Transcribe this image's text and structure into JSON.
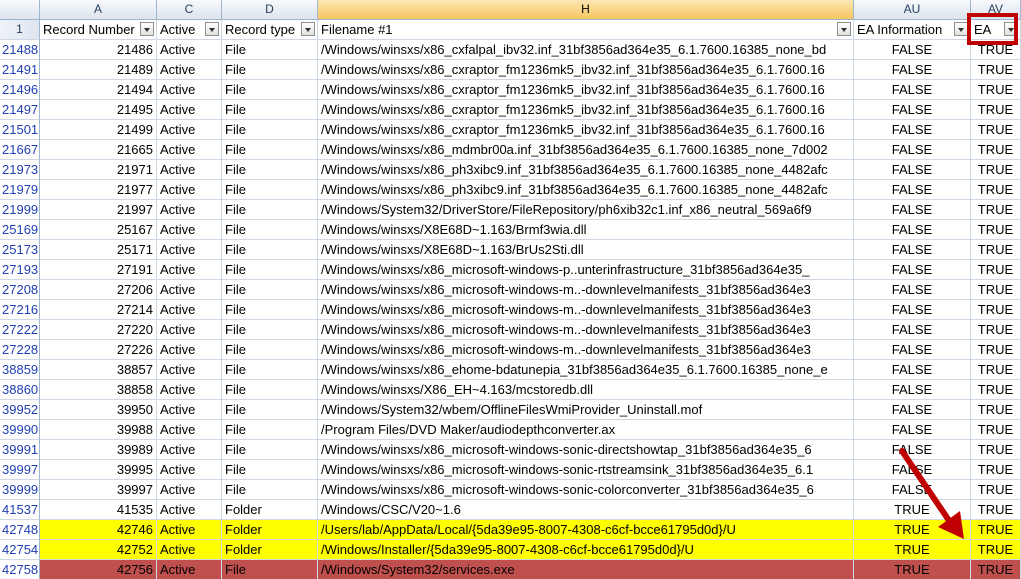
{
  "columns": {
    "corner": "",
    "letters": [
      "A",
      "C",
      "D",
      "H",
      "AU",
      "AV"
    ],
    "header_row_number": "1",
    "headers": [
      "Record Number",
      "Active",
      "Record type",
      "Filename #1",
      "EA Information",
      "EA"
    ]
  },
  "rows": [
    {
      "row": "21488",
      "rec": "21486",
      "active": "Active",
      "type": "File",
      "file": "/Windows/winsxs/x86_cxfalpal_ibv32.inf_31bf3856ad364e35_6.1.7600.16385_none_bd",
      "eai": "FALSE",
      "ea": "TRUE"
    },
    {
      "row": "21491",
      "rec": "21489",
      "active": "Active",
      "type": "File",
      "file": "/Windows/winsxs/x86_cxraptor_fm1236mk5_ibv32.inf_31bf3856ad364e35_6.1.7600.16",
      "eai": "FALSE",
      "ea": "TRUE"
    },
    {
      "row": "21496",
      "rec": "21494",
      "active": "Active",
      "type": "File",
      "file": "/Windows/winsxs/x86_cxraptor_fm1236mk5_ibv32.inf_31bf3856ad364e35_6.1.7600.16",
      "eai": "FALSE",
      "ea": "TRUE"
    },
    {
      "row": "21497",
      "rec": "21495",
      "active": "Active",
      "type": "File",
      "file": "/Windows/winsxs/x86_cxraptor_fm1236mk5_ibv32.inf_31bf3856ad364e35_6.1.7600.16",
      "eai": "FALSE",
      "ea": "TRUE"
    },
    {
      "row": "21501",
      "rec": "21499",
      "active": "Active",
      "type": "File",
      "file": "/Windows/winsxs/x86_cxraptor_fm1236mk5_ibv32.inf_31bf3856ad364e35_6.1.7600.16",
      "eai": "FALSE",
      "ea": "TRUE"
    },
    {
      "row": "21667",
      "rec": "21665",
      "active": "Active",
      "type": "File",
      "file": "/Windows/winsxs/x86_mdmbr00a.inf_31bf3856ad364e35_6.1.7600.16385_none_7d002",
      "eai": "FALSE",
      "ea": "TRUE"
    },
    {
      "row": "21973",
      "rec": "21971",
      "active": "Active",
      "type": "File",
      "file": "/Windows/winsxs/x86_ph3xibc9.inf_31bf3856ad364e35_6.1.7600.16385_none_4482afc",
      "eai": "FALSE",
      "ea": "TRUE"
    },
    {
      "row": "21979",
      "rec": "21977",
      "active": "Active",
      "type": "File",
      "file": "/Windows/winsxs/x86_ph3xibc9.inf_31bf3856ad364e35_6.1.7600.16385_none_4482afc",
      "eai": "FALSE",
      "ea": "TRUE"
    },
    {
      "row": "21999",
      "rec": "21997",
      "active": "Active",
      "type": "File",
      "file": "/Windows/System32/DriverStore/FileRepository/ph6xib32c1.inf_x86_neutral_569a6f9",
      "eai": "FALSE",
      "ea": "TRUE"
    },
    {
      "row": "25169",
      "rec": "25167",
      "active": "Active",
      "type": "File",
      "file": "/Windows/winsxs/X8E68D~1.163/Brmf3wia.dll",
      "eai": "FALSE",
      "ea": "TRUE"
    },
    {
      "row": "25173",
      "rec": "25171",
      "active": "Active",
      "type": "File",
      "file": "/Windows/winsxs/X8E68D~1.163/BrUs2Sti.dll",
      "eai": "FALSE",
      "ea": "TRUE"
    },
    {
      "row": "27193",
      "rec": "27191",
      "active": "Active",
      "type": "File",
      "file": "/Windows/winsxs/x86_microsoft-windows-p..unterinfrastructure_31bf3856ad364e35_",
      "eai": "FALSE",
      "ea": "TRUE"
    },
    {
      "row": "27208",
      "rec": "27206",
      "active": "Active",
      "type": "File",
      "file": "/Windows/winsxs/x86_microsoft-windows-m..-downlevelmanifests_31bf3856ad364e3",
      "eai": "FALSE",
      "ea": "TRUE"
    },
    {
      "row": "27216",
      "rec": "27214",
      "active": "Active",
      "type": "File",
      "file": "/Windows/winsxs/x86_microsoft-windows-m..-downlevelmanifests_31bf3856ad364e3",
      "eai": "FALSE",
      "ea": "TRUE"
    },
    {
      "row": "27222",
      "rec": "27220",
      "active": "Active",
      "type": "File",
      "file": "/Windows/winsxs/x86_microsoft-windows-m..-downlevelmanifests_31bf3856ad364e3",
      "eai": "FALSE",
      "ea": "TRUE"
    },
    {
      "row": "27228",
      "rec": "27226",
      "active": "Active",
      "type": "File",
      "file": "/Windows/winsxs/x86_microsoft-windows-m..-downlevelmanifests_31bf3856ad364e3",
      "eai": "FALSE",
      "ea": "TRUE"
    },
    {
      "row": "38859",
      "rec": "38857",
      "active": "Active",
      "type": "File",
      "file": "/Windows/winsxs/x86_ehome-bdatunepia_31bf3856ad364e35_6.1.7600.16385_none_e",
      "eai": "FALSE",
      "ea": "TRUE"
    },
    {
      "row": "38860",
      "rec": "38858",
      "active": "Active",
      "type": "File",
      "file": "/Windows/winsxs/X86_EH~4.163/mcstoredb.dll",
      "eai": "FALSE",
      "ea": "TRUE"
    },
    {
      "row": "39952",
      "rec": "39950",
      "active": "Active",
      "type": "File",
      "file": "/Windows/System32/wbem/OfflineFilesWmiProvider_Uninstall.mof",
      "eai": "FALSE",
      "ea": "TRUE"
    },
    {
      "row": "39990",
      "rec": "39988",
      "active": "Active",
      "type": "File",
      "file": "/Program Files/DVD Maker/audiodepthconverter.ax",
      "eai": "FALSE",
      "ea": "TRUE"
    },
    {
      "row": "39991",
      "rec": "39989",
      "active": "Active",
      "type": "File",
      "file": "/Windows/winsxs/x86_microsoft-windows-sonic-directshowtap_31bf3856ad364e35_6",
      "eai": "FALSE",
      "ea": "TRUE"
    },
    {
      "row": "39997",
      "rec": "39995",
      "active": "Active",
      "type": "File",
      "file": "/Windows/winsxs/x86_microsoft-windows-sonic-rtstreamsink_31bf3856ad364e35_6.1",
      "eai": "FALSE",
      "ea": "TRUE"
    },
    {
      "row": "39999",
      "rec": "39997",
      "active": "Active",
      "type": "File",
      "file": "/Windows/winsxs/x86_microsoft-windows-sonic-colorconverter_31bf3856ad364e35_6",
      "eai": "FALSE",
      "ea": "TRUE"
    },
    {
      "row": "41537",
      "rec": "41535",
      "active": "Active",
      "type": "Folder",
      "file": "/Windows/CSC/V20~1.6",
      "eai": "TRUE",
      "ea": "TRUE"
    },
    {
      "row": "42748",
      "rec": "42746",
      "active": "Active",
      "type": "Folder",
      "file": "/Users/lab/AppData/Local/{5da39e95-8007-4308-c6cf-bcce61795d0d}/U",
      "eai": "TRUE",
      "ea": "TRUE",
      "highlight": "yellow"
    },
    {
      "row": "42754",
      "rec": "42752",
      "active": "Active",
      "type": "Folder",
      "file": "/Windows/Installer/{5da39e95-8007-4308-c6cf-bcce61795d0d}/U",
      "eai": "TRUE",
      "ea": "TRUE",
      "highlight": "yellow"
    },
    {
      "row": "42758",
      "rec": "42756",
      "active": "Active",
      "type": "File",
      "file": "/Windows/System32/services.exe",
      "eai": "TRUE",
      "ea": "TRUE",
      "highlight": "red"
    }
  ],
  "colors": {
    "yellow": "#ffff00",
    "red": "#c0504d",
    "annotation": "#c00000"
  },
  "icons": {
    "filter": "filter-dropdown-icon",
    "arrow": "red-arrow-annotation"
  }
}
